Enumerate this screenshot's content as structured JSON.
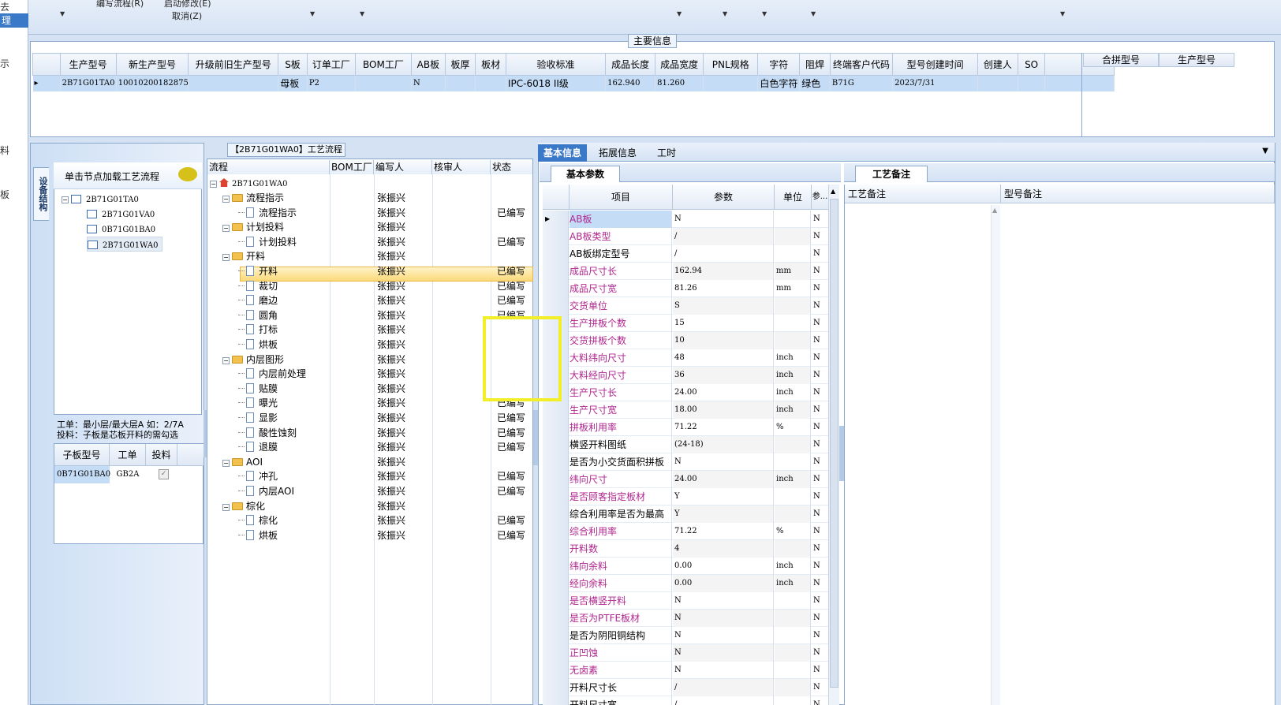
{
  "leftstrip": {
    "items": [
      "去",
      "理",
      "示",
      "料",
      "板"
    ]
  },
  "toolbar": {
    "edit_flow": "编写流程(R)",
    "enable_modify": "启动修改(E)",
    "cancel": "取消(Z)"
  },
  "main_info": {
    "title": "主要信息",
    "columns": [
      "生产型号",
      "新生产型号",
      "升级前旧生产型号",
      "S板",
      "订单工厂",
      "BOM工厂",
      "AB板",
      "板厚",
      "板材",
      "验收标准",
      "成品长度",
      "成品宽度",
      "PNL规格",
      "字符",
      "阻焊",
      "终端客户代码",
      "型号创建时间",
      "创建人",
      "SO"
    ],
    "row": [
      "2B71G01TA0",
      "10010200182875",
      "",
      "母板",
      "P2",
      "",
      "N",
      "",
      "",
      "IPC-6018 II级",
      "162.940",
      "81.260",
      "",
      "白色字符",
      "绿色",
      "B71G",
      "2023/7/31",
      "",
      ""
    ],
    "side_columns": [
      "合拼型号",
      "生产型号"
    ]
  },
  "device_panel": {
    "tab_label": "设备结构",
    "hint": "单击节点加载工艺流程",
    "tree": [
      "2B71G01TA0",
      "2B71G01VA0",
      "0B71G01BA0",
      "2B71G01WA0"
    ],
    "note_line1": "工单：最小层/最大层A 如：2/7A",
    "note_line2": "投料：子板是芯板开料的需勾选",
    "child_columns": [
      "子板型号",
      "工单",
      "投料"
    ],
    "child_row": [
      "0B71G01BA0",
      "GB2A",
      "✓"
    ]
  },
  "flow": {
    "title": "【2B71G01WA0】工艺流程",
    "columns": [
      "流程",
      "BOM工厂",
      "编写人",
      "核审人",
      "状态"
    ],
    "root": "2B71G01WA0",
    "rows": [
      {
        "name": "流程指示",
        "type": "folder",
        "writer": "张振兴",
        "status": ""
      },
      {
        "name": "流程指示",
        "type": "doc",
        "writer": "张振兴",
        "status": "已编写"
      },
      {
        "name": "计划投料",
        "type": "folder",
        "writer": "张振兴",
        "status": ""
      },
      {
        "name": "计划投料",
        "type": "doc",
        "writer": "张振兴",
        "status": "已编写"
      },
      {
        "name": "开料",
        "type": "folder",
        "writer": "张振兴",
        "status": ""
      },
      {
        "name": "开料",
        "type": "doc",
        "writer": "张振兴",
        "status": "已编写"
      },
      {
        "name": "裁切",
        "type": "doc",
        "writer": "张振兴",
        "status": "已编写"
      },
      {
        "name": "磨边",
        "type": "doc",
        "writer": "张振兴",
        "status": "已编写"
      },
      {
        "name": "圆角",
        "type": "doc",
        "writer": "张振兴",
        "status": "已编写"
      },
      {
        "name": "打标",
        "type": "doc",
        "writer": "张振兴",
        "status": ""
      },
      {
        "name": "烘板",
        "type": "doc",
        "writer": "张振兴",
        "status": ""
      },
      {
        "name": "内层图形",
        "type": "folder",
        "writer": "张振兴",
        "status": ""
      },
      {
        "name": "内层前处理",
        "type": "doc",
        "writer": "张振兴",
        "status": ""
      },
      {
        "name": "贴膜",
        "type": "doc",
        "writer": "张振兴",
        "status": ""
      },
      {
        "name": "曝光",
        "type": "doc",
        "writer": "张振兴",
        "status": "已编写"
      },
      {
        "name": "显影",
        "type": "doc",
        "writer": "张振兴",
        "status": "已编写"
      },
      {
        "name": "酸性蚀刻",
        "type": "doc",
        "writer": "张振兴",
        "status": "已编写"
      },
      {
        "name": "退膜",
        "type": "doc",
        "writer": "张振兴",
        "status": "已编写"
      },
      {
        "name": "AOI",
        "type": "folder",
        "writer": "张振兴",
        "status": ""
      },
      {
        "name": "冲孔",
        "type": "doc",
        "writer": "张振兴",
        "status": "已编写"
      },
      {
        "name": "内层AOI",
        "type": "doc",
        "writer": "张振兴",
        "status": "已编写"
      },
      {
        "name": "棕化",
        "type": "folder",
        "writer": "张振兴",
        "status": ""
      },
      {
        "name": "棕化",
        "type": "doc",
        "writer": "张振兴",
        "status": "已编写"
      },
      {
        "name": "烘板",
        "type": "doc",
        "writer": "张振兴",
        "status": "已编写"
      }
    ]
  },
  "right_tabs": [
    "基本信息",
    "拓展信息",
    "工时"
  ],
  "params": {
    "tab": "基本参数",
    "columns": [
      "项目",
      "参数",
      "单位",
      "参..."
    ],
    "rows": [
      {
        "item": "AB板",
        "value": "N",
        "unit": "",
        "flag": "N",
        "magenta": true
      },
      {
        "item": "AB板类型",
        "value": "/",
        "unit": "",
        "flag": "N",
        "magenta": true
      },
      {
        "item": "AB板绑定型号",
        "value": "/",
        "unit": "",
        "flag": "N",
        "magenta": false
      },
      {
        "item": "成品尺寸长",
        "value": "162.94",
        "unit": "mm",
        "flag": "N",
        "magenta": true
      },
      {
        "item": "成品尺寸宽",
        "value": "81.26",
        "unit": "mm",
        "flag": "N",
        "magenta": true
      },
      {
        "item": "交货单位",
        "value": "S",
        "unit": "",
        "flag": "N",
        "magenta": true
      },
      {
        "item": "生产拼板个数",
        "value": "15",
        "unit": "",
        "flag": "N",
        "magenta": true
      },
      {
        "item": "交货拼板个数",
        "value": "10",
        "unit": "",
        "flag": "N",
        "magenta": true
      },
      {
        "item": "大料纬向尺寸",
        "value": "48",
        "unit": "inch",
        "flag": "N",
        "magenta": true
      },
      {
        "item": "大料经向尺寸",
        "value": "36",
        "unit": "inch",
        "flag": "N",
        "magenta": true
      },
      {
        "item": "生产尺寸长",
        "value": "24.00",
        "unit": "inch",
        "flag": "N",
        "magenta": true
      },
      {
        "item": "生产尺寸宽",
        "value": "18.00",
        "unit": "inch",
        "flag": "N",
        "magenta": true
      },
      {
        "item": "拼板利用率",
        "value": "71.22",
        "unit": "%",
        "flag": "N",
        "magenta": true
      },
      {
        "item": "横竖开料图纸",
        "value": "(24-18)",
        "unit": "",
        "flag": "N",
        "magenta": false
      },
      {
        "item": "是否为小交货面积拼板",
        "value": "N",
        "unit": "",
        "flag": "N",
        "magenta": false
      },
      {
        "item": "纬向尺寸",
        "value": "24.00",
        "unit": "inch",
        "flag": "N",
        "magenta": true
      },
      {
        "item": "是否顾客指定板材",
        "value": "Y",
        "unit": "",
        "flag": "N",
        "magenta": true
      },
      {
        "item": "综合利用率是否为最高",
        "value": "Y",
        "unit": "",
        "flag": "N",
        "magenta": false
      },
      {
        "item": "综合利用率",
        "value": "71.22",
        "unit": "%",
        "flag": "N",
        "magenta": true
      },
      {
        "item": "开料数",
        "value": "4",
        "unit": "",
        "flag": "N",
        "magenta": true
      },
      {
        "item": "纬向余料",
        "value": "0.00",
        "unit": "inch",
        "flag": "N",
        "magenta": true
      },
      {
        "item": "经向余料",
        "value": "0.00",
        "unit": "inch",
        "flag": "N",
        "magenta": true
      },
      {
        "item": "是否横竖开料",
        "value": "N",
        "unit": "",
        "flag": "N",
        "magenta": true
      },
      {
        "item": "是否为PTFE板材",
        "value": "N",
        "unit": "",
        "flag": "N",
        "magenta": true
      },
      {
        "item": "是否为阴阳铜结构",
        "value": "N",
        "unit": "",
        "flag": "N",
        "magenta": false
      },
      {
        "item": "正凹蚀",
        "value": "N",
        "unit": "",
        "flag": "N",
        "magenta": true
      },
      {
        "item": "无卤素",
        "value": "N",
        "unit": "",
        "flag": "N",
        "magenta": true
      },
      {
        "item": "开料尺寸长",
        "value": "/",
        "unit": "",
        "flag": "N",
        "magenta": false
      },
      {
        "item": "开料尺寸宽",
        "value": "/",
        "unit": "",
        "flag": "N",
        "magenta": false
      }
    ]
  },
  "craft": {
    "tab": "工艺备注",
    "col1": "工艺备注",
    "col2": "型号备注"
  }
}
